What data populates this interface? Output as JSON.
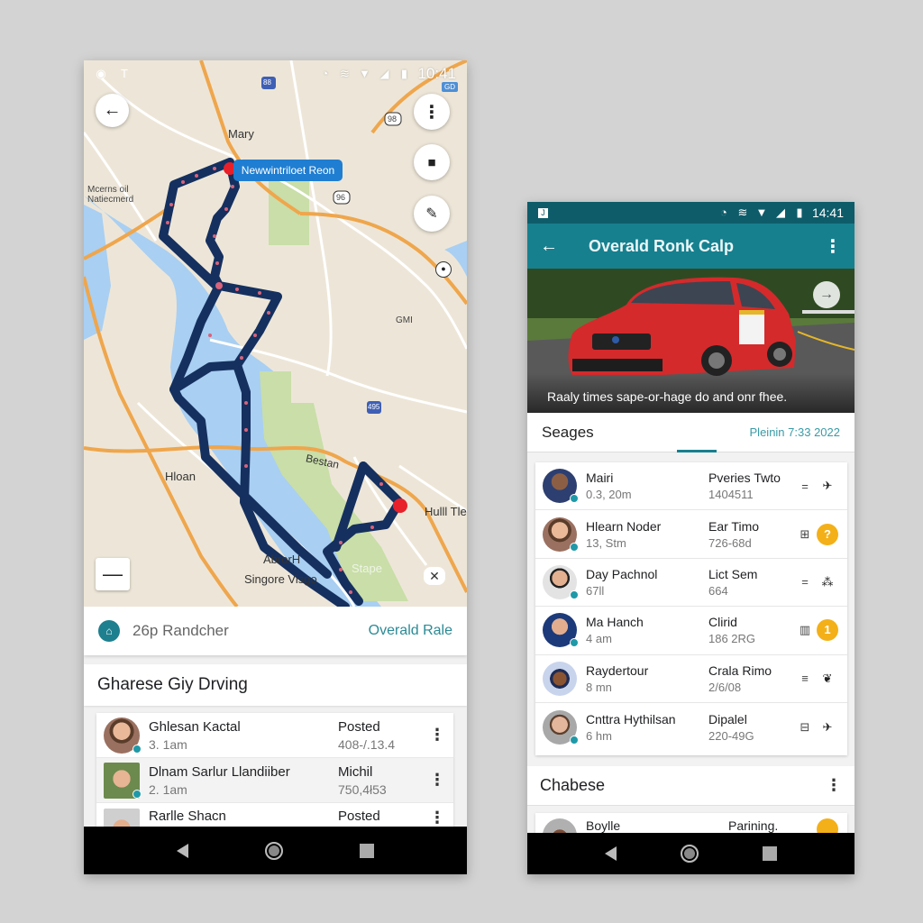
{
  "left_screen": {
    "status_bar": {
      "left_icons": [
        "notification-icon",
        "signal-tower-icon"
      ],
      "right_icons": [
        "alarm-icon",
        "nfc-icon",
        "wifi-icon",
        "cell-signal-icon",
        "battery-icon"
      ],
      "time": "10:41",
      "badge": "GD"
    },
    "map": {
      "callout": "Newwintriloet Reon",
      "route_color": "#15305f",
      "marker_color": "#e8202a",
      "labels": {
        "mary": "Mary",
        "moor": "Mcerns oil\nNatiecmerd",
        "hloan": "Hloan",
        "bestan": "Bestan",
        "hulll": "Hulll Tle",
        "aroor": "AbrorH",
        "singore": "Singore Visgo",
        "gmi": "GMI",
        "stape": "Stape",
        "hwy_88": "88",
        "hwy_98": "98",
        "hwy_96": "96",
        "hwy_495": "495"
      }
    },
    "summary": {
      "text": "26p Randcher",
      "link": "Overald Rale"
    },
    "section_title": "Gharese Giy Drving",
    "list": [
      {
        "name": "Ghlesan Kactal",
        "time": "3. 1am",
        "status": "Posted",
        "value": "408-/.13.4"
      },
      {
        "name": "Dlnam Sarlur Llandiiber",
        "time": "2. 1am",
        "status": "Michil",
        "value": "750,4ł53"
      },
      {
        "name": "Rarlle Shacn",
        "time": "",
        "status": "Posted",
        "value": ""
      }
    ]
  },
  "right_screen": {
    "status_bar": {
      "left_icon": "sim-icon",
      "right_icons": [
        "alarm-icon",
        "nfc-icon",
        "wifi-icon",
        "cell-signal-icon",
        "battery-icon"
      ],
      "time": "14:41"
    },
    "app_bar": {
      "title": "Overald Ronk Calp"
    },
    "hero": {
      "caption": "Raaly times sape-or-hage do and onr fhee.",
      "car_color": "#d42a2c"
    },
    "tab": {
      "title": "Seages",
      "date": "Pleinin 7:33 2022"
    },
    "list": [
      {
        "name": "Mairi",
        "time": "0.3, 20m",
        "status": "Pveries Twto",
        "value": "1404511",
        "icon1": "=",
        "icon2": "✈",
        "badge": ""
      },
      {
        "name": "Hlearn Noder",
        "time": "13, Stm",
        "status": "Ear Timo",
        "value": "726-68d",
        "icon1": "⊞",
        "icon2": "",
        "badge": "?"
      },
      {
        "name": "Day Pachnol",
        "time": "67ll",
        "status": "Lict Sem",
        "value": "664",
        "icon1": "=",
        "icon2": "⁂",
        "badge": ""
      },
      {
        "name": "Ma Hanch",
        "time": "4 am",
        "status": "Clirid",
        "value": "186 2RG",
        "icon1": "▥",
        "icon2": "",
        "badge": "1"
      },
      {
        "name": "Raydertour",
        "time": "8 mn",
        "status": "Crala Rimo",
        "value": "2/6/08",
        "icon1": "≡",
        "icon2": "❦",
        "badge": ""
      },
      {
        "name": "Cnttra Hythilsan",
        "time": "6 hm",
        "status": "Dipalel",
        "value": "220-49G",
        "icon1": "⊟",
        "icon2": "✈",
        "badge": ""
      }
    ],
    "section_title": "Chabese",
    "list2": [
      {
        "name": "Boylle",
        "status": "Parining."
      }
    ]
  }
}
